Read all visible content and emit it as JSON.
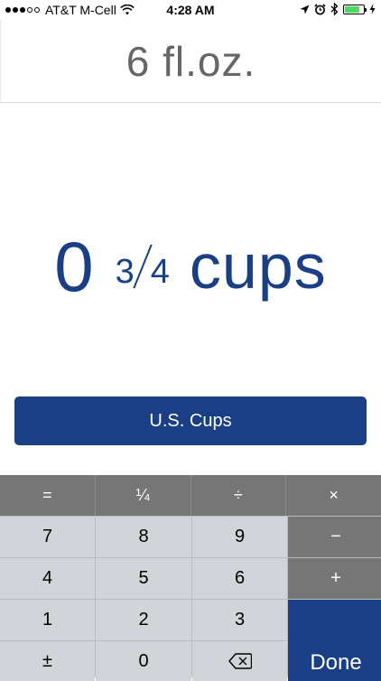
{
  "status_bar": {
    "carrier": "AT&T M-Cell",
    "time": "4:28 AM",
    "battery_level": 0.8,
    "icons": [
      "signal-dots",
      "wifi-icon",
      "location-icon",
      "alarm-icon",
      "bluetooth-icon",
      "battery-icon",
      "charging-icon"
    ]
  },
  "input": {
    "value": "6 fl.oz."
  },
  "result": {
    "whole": "0",
    "numerator": "3",
    "denominator": "4",
    "unit": "cups"
  },
  "unit_button": {
    "label": "U.S. Cups"
  },
  "keypad": {
    "op_row": [
      "=",
      "¼",
      "÷",
      "×"
    ],
    "row1": [
      "7",
      "8",
      "9",
      "−"
    ],
    "row2": [
      "4",
      "5",
      "6",
      "+"
    ],
    "row3": [
      "1",
      "2",
      "3"
    ],
    "row4": [
      "±",
      "0"
    ],
    "done_label": "Done"
  },
  "colors": {
    "accent": "#1b3f84",
    "input_text": "#666666",
    "key_light": "#d1d4d8",
    "key_dark": "#767676",
    "battery_green": "#4cd964"
  }
}
